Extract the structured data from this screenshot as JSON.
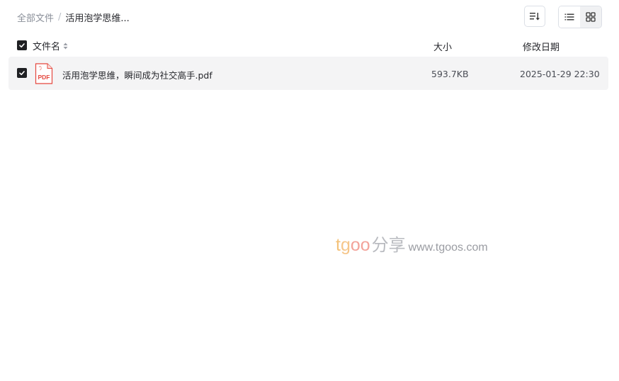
{
  "breadcrumb": {
    "root": "全部文件",
    "separator": "/",
    "current": "活用泡学思维..."
  },
  "toolbar": {
    "sort_icon": "sort-icon",
    "list_view_icon": "list-view-icon",
    "grid_view_icon": "grid-view-icon",
    "active_view": "grid"
  },
  "table": {
    "header": {
      "name": "文件名",
      "size": "大小",
      "date": "修改日期",
      "checked": true
    },
    "rows": [
      {
        "checked": true,
        "icon": "pdf-file-icon",
        "icon_label": "PDF",
        "name": "活用泡学思维，瞬间成为社交高手.pdf",
        "size": "593.7KB",
        "date": "2025-01-29 22:30"
      }
    ]
  },
  "watermark": {
    "t": "t",
    "g": "g",
    "oo": "oo",
    "cn": "分享",
    "url": "www.tgoos.com"
  },
  "colors": {
    "checkbox": "#1f2023",
    "row_background": "#f4f4f5",
    "pdf_red": "#e5483f"
  }
}
